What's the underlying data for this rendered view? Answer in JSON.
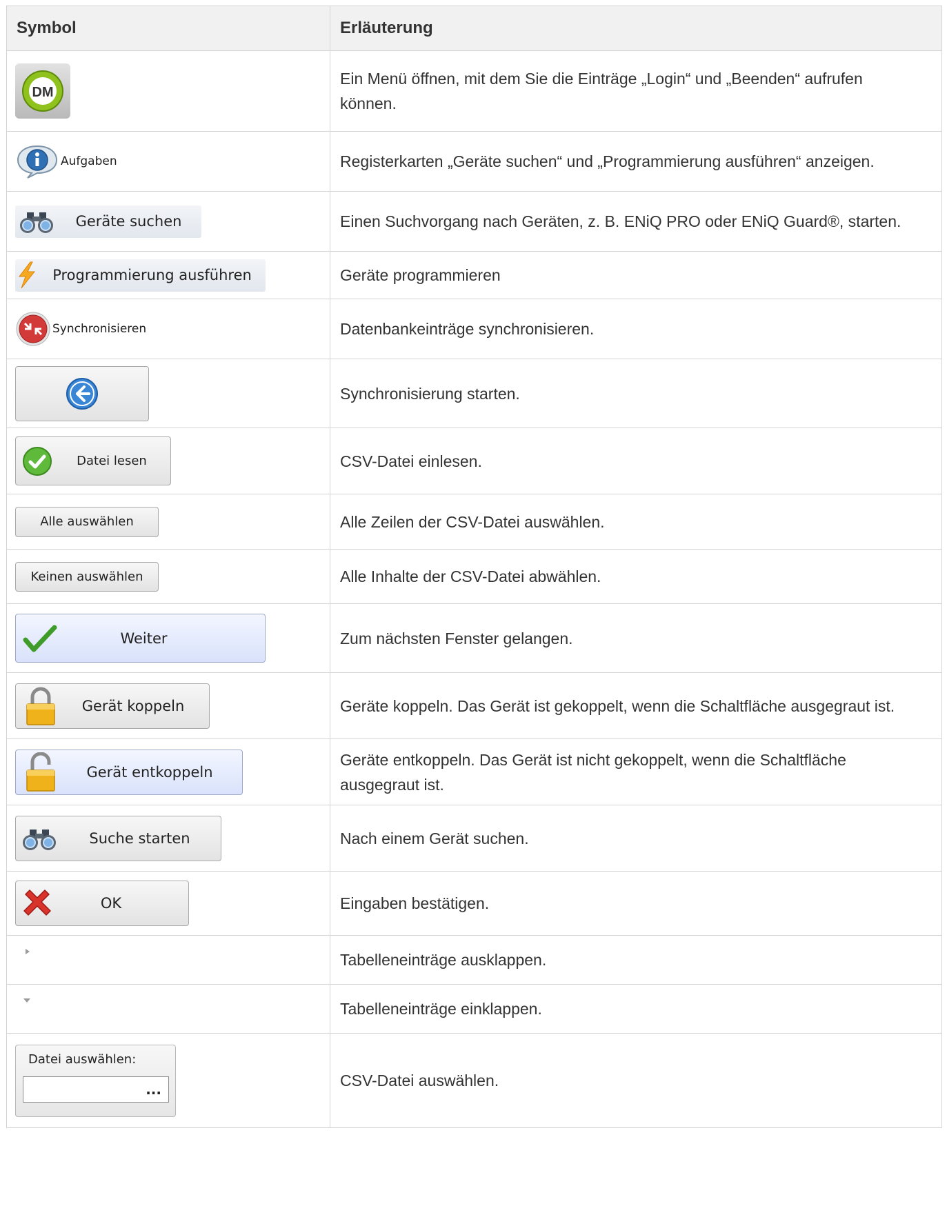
{
  "header": {
    "symbol": "Symbol",
    "description": "Erläuterung"
  },
  "rows": [
    {
      "icon": "dm-logo-icon",
      "label": "DM",
      "description": "Ein Menü öffnen, mit dem Sie die Einträge „Login“ und „Beenden“ aufrufen können."
    },
    {
      "icon": "info-bubble-icon",
      "label": "Aufgaben",
      "description": "Registerkarten „Geräte suchen“ und „Programmierung ausführen“ anzeigen."
    },
    {
      "icon": "binoculars-icon",
      "label": "Geräte suchen",
      "description": "Einen Suchvorgang nach Geräten, z. B. ENiQ PRO oder ENiQ Guard®, starten."
    },
    {
      "icon": "lightning-icon",
      "label": "Programmierung ausführen",
      "description": "Geräte programmieren"
    },
    {
      "icon": "sync-icon",
      "label": "Synchronisieren",
      "description": "Datenbankeinträge synchronisieren."
    },
    {
      "icon": "arrow-left-circle-icon",
      "label": "",
      "description": "Synchronisierung starten."
    },
    {
      "icon": "check-circle-icon",
      "label": "Datei lesen",
      "description": "CSV-Datei einlesen."
    },
    {
      "icon": "",
      "label": "Alle auswählen",
      "description": "Alle Zeilen der CSV-Datei auswählen."
    },
    {
      "icon": "",
      "label": "Keinen auswählen",
      "description": "Alle Inhalte der CSV-Datei abwählen."
    },
    {
      "icon": "checkmark-icon",
      "label": "Weiter",
      "description": "Zum nächsten Fenster gelangen."
    },
    {
      "icon": "lock-closed-icon",
      "label": "Gerät koppeln",
      "description": "Geräte koppeln. Das Gerät ist gekoppelt, wenn die Schaltfläche ausgegraut ist."
    },
    {
      "icon": "lock-open-icon",
      "label": "Gerät entkoppeln",
      "description": "Geräte entkoppeln. Das Gerät ist nicht gekoppelt, wenn die Schaltfläche ausgegraut ist."
    },
    {
      "icon": "binoculars-icon",
      "label": "Suche starten",
      "description": "Nach einem Gerät suchen."
    },
    {
      "icon": "red-x-icon",
      "label": "OK",
      "description": "Eingaben bestätigen."
    },
    {
      "icon": "triangle-right-icon",
      "label": "",
      "description": "Tabelleneinträge ausklappen."
    },
    {
      "icon": "triangle-down-icon",
      "label": "",
      "description": "Tabelleneinträge einklappen."
    },
    {
      "icon": "ellipsis-icon",
      "label": "Datei auswählen:",
      "value": "...",
      "description": "CSV-Datei auswählen."
    }
  ],
  "colors": {
    "header_bg": "#f1f1f1",
    "border": "#d4d4d4",
    "text": "#333333",
    "button_blue": "#d9e2fb"
  }
}
